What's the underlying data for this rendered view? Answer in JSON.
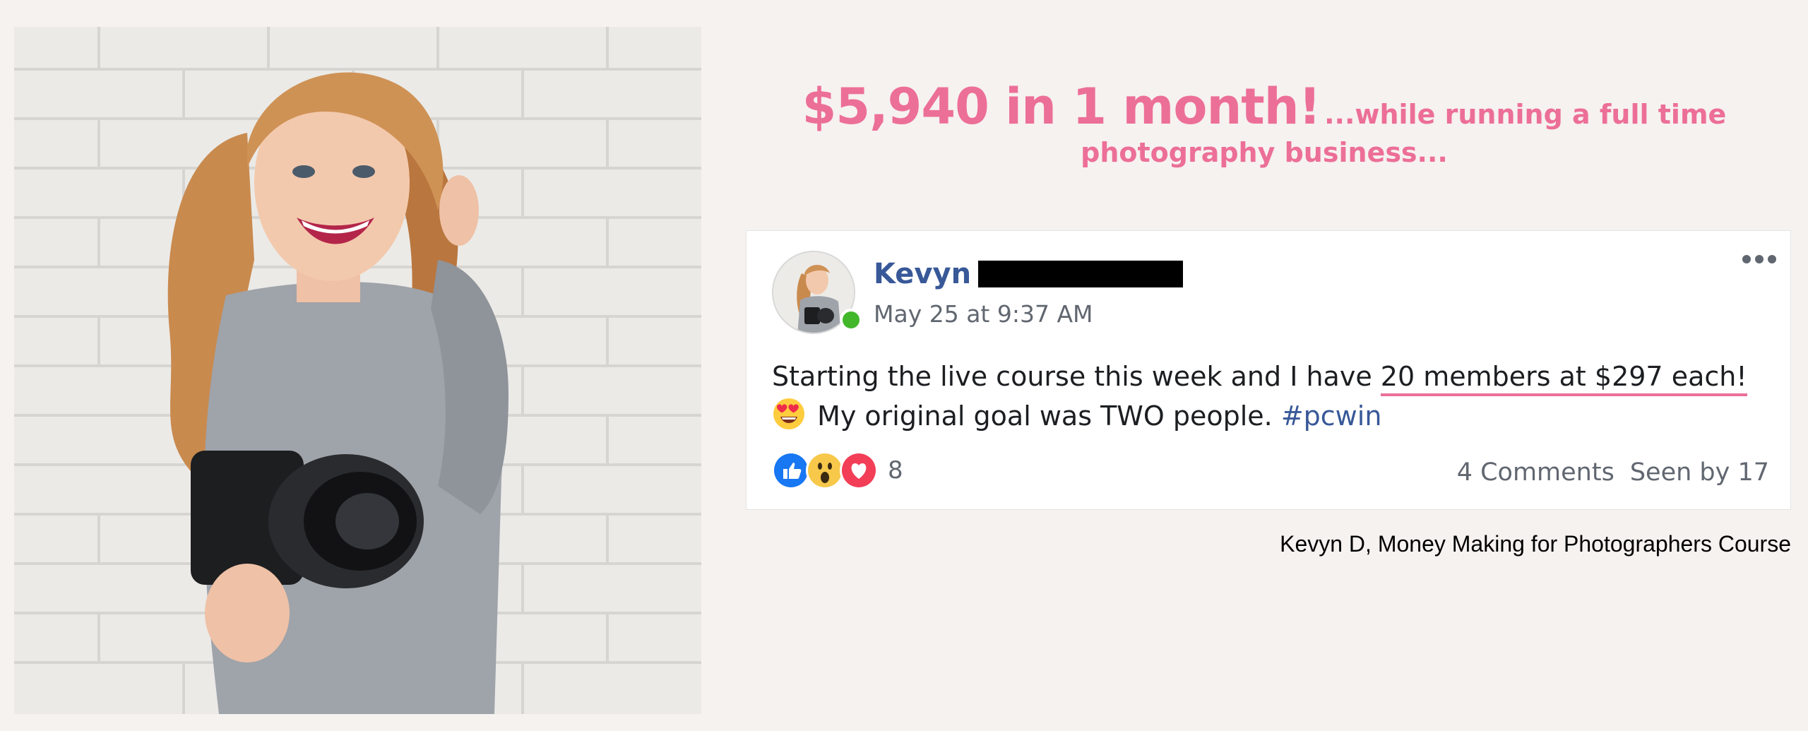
{
  "headline": {
    "big": "$5,940 in 1 month!",
    "small_line1": "...while running a full time",
    "small_line2": "photography business..."
  },
  "post": {
    "author_name": "Kevyn",
    "timestamp": "May 25 at 9:37 AM",
    "more_icon": "ellipsis-icon",
    "body_part1": "Starting the live course this week and I have ",
    "body_highlight": "20 members at $297 each!",
    "body_part2": " My original goal was TWO people. ",
    "hashtag": "#pcwin",
    "reactions": {
      "icons": [
        "like-icon",
        "wow-icon",
        "love-icon"
      ],
      "count": "8"
    },
    "comments": "4 Comments",
    "seen_by": "Seen by 17"
  },
  "caption": "Kevyn D, Money Making for Photographers Course",
  "colors": {
    "accent_pink": "#ec6f98",
    "facebook_blue": "#385898",
    "online_green": "#42b72a",
    "background": "#f6f2ef"
  }
}
